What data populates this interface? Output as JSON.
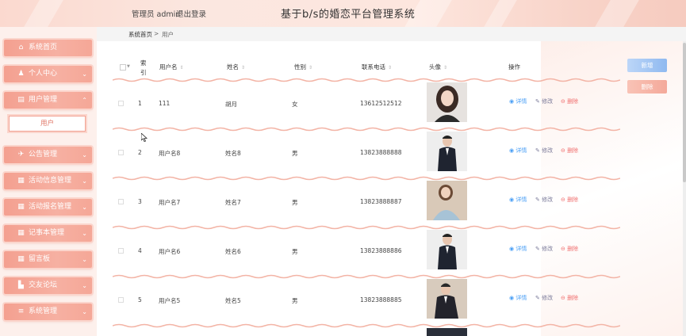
{
  "header": {
    "admin_text": "管理员 admin",
    "logout": "退出登录",
    "title": "基于b/s的婚恋平台管理系统"
  },
  "sidebar": {
    "items": [
      {
        "label": "系统首页",
        "icon": "home-icon",
        "glyph": "⌂"
      },
      {
        "label": "个人中心",
        "icon": "person-icon",
        "glyph": "♟"
      },
      {
        "label": "用户管理",
        "icon": "users-icon",
        "glyph": "▤"
      },
      {
        "label": "公告管理",
        "icon": "megaphone-icon",
        "glyph": "✈"
      },
      {
        "label": "活动信息管理",
        "icon": "grid-icon",
        "glyph": "▦"
      },
      {
        "label": "活动报名管理",
        "icon": "grid-icon",
        "glyph": "▦"
      },
      {
        "label": "记事本管理",
        "icon": "grid-icon",
        "glyph": "▦"
      },
      {
        "label": "留言板",
        "icon": "grid-icon",
        "glyph": "▦"
      },
      {
        "label": "交友论坛",
        "icon": "folder-icon",
        "glyph": "▙"
      },
      {
        "label": "系统管理",
        "icon": "list-icon",
        "glyph": "≡"
      }
    ],
    "sub_item": "用户"
  },
  "breadcrumb": {
    "home": "系统首页",
    "separator": ">",
    "current": "用户"
  },
  "toolbar": {
    "add": "新增",
    "delete": "删除"
  },
  "table": {
    "headers": {
      "index": "索引",
      "username": "用户名",
      "name": "姓名",
      "gender": "性别",
      "phone": "联系电话",
      "avatar": "头像",
      "ops": "操作"
    },
    "ops": {
      "detail": "详情",
      "edit": "修改",
      "delete": "删除"
    },
    "rows": [
      {
        "index": "1",
        "username": "111",
        "name": "胡月",
        "gender": "女",
        "phone": "13612512512"
      },
      {
        "index": "2",
        "username": "用户名8",
        "name": "姓名8",
        "gender": "男",
        "phone": "13823888888"
      },
      {
        "index": "3",
        "username": "用户名7",
        "name": "姓名7",
        "gender": "男",
        "phone": "13823888887"
      },
      {
        "index": "4",
        "username": "用户名6",
        "name": "姓名6",
        "gender": "男",
        "phone": "13823888886"
      },
      {
        "index": "5",
        "username": "用户名5",
        "name": "姓名5",
        "gender": "男",
        "phone": "13823888885"
      }
    ]
  },
  "colors": {
    "accent_pink": "#f4a090",
    "link_blue": "#4a9ff5",
    "delete_red": "#f06f6f"
  }
}
